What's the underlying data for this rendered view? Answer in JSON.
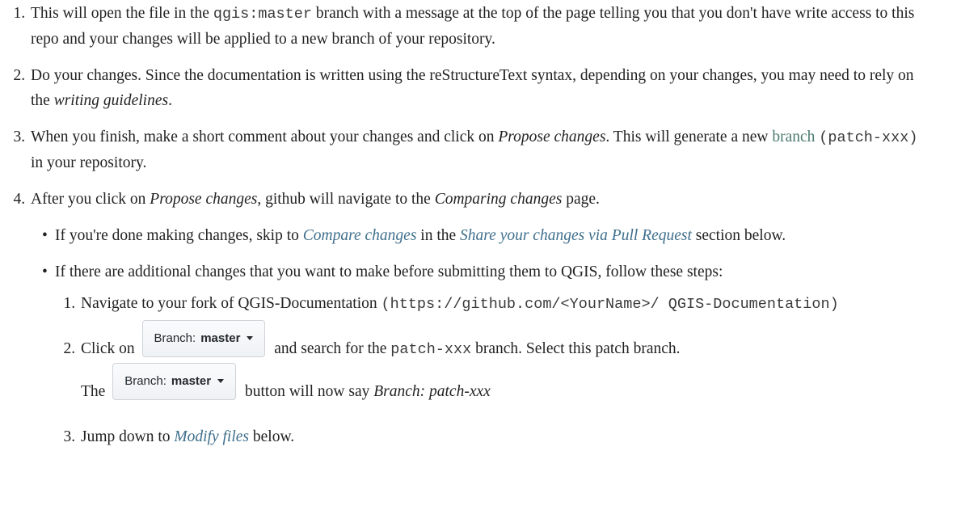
{
  "steps": {
    "s1": {
      "a": "This will open the file in the ",
      "code": "qgis:master",
      "b": " branch with a message at the top of the page telling you that you don't have write access to this repo and your changes will be applied to a new branch of your repository."
    },
    "s2": {
      "a": "Do your changes. Since the documentation is written using the reStructureText syntax, depending on your changes, you may need to rely on the ",
      "em": "writing guidelines",
      "b": "."
    },
    "s3": {
      "a": "When you finish, make a short comment about your changes and click on ",
      "em": "Propose changes",
      "b": ". This will generate a new ",
      "link": "branch",
      "c": " ",
      "code": "(patch-xxx)",
      "d": " in your repository."
    },
    "s4": {
      "a": "After you click on ",
      "em1": "Propose changes",
      "b": ", github will navigate to the ",
      "em2": "Comparing changes",
      "c": " page."
    }
  },
  "bullets": {
    "b1": {
      "a": "If you're done making changes, skip to ",
      "link1": "Compare changes",
      "b": " in the ",
      "link2": "Share your changes via Pull Request",
      "c": " section below."
    },
    "b2": {
      "a": "If there are additional changes that you want to make before submitting them to QGIS, follow these steps:"
    }
  },
  "inner": {
    "i1": {
      "a": "Navigate to your fork of QGIS-Documentation ",
      "code": "(https://github.com/<YourName>/ QGIS-Documentation)"
    },
    "i2": {
      "a": "Click on",
      "b": " and search for the ",
      "code": "patch-xxx",
      "c": " branch. Select this patch branch.",
      "d": "The",
      "e": " button will now say ",
      "em": "Branch: patch-xxx"
    },
    "i3": {
      "a": "Jump down to ",
      "link": "Modify files",
      "b": " below."
    }
  },
  "branch_button": {
    "prefix": "Branch:",
    "name": "master",
    "icon": "caret-down-icon"
  }
}
